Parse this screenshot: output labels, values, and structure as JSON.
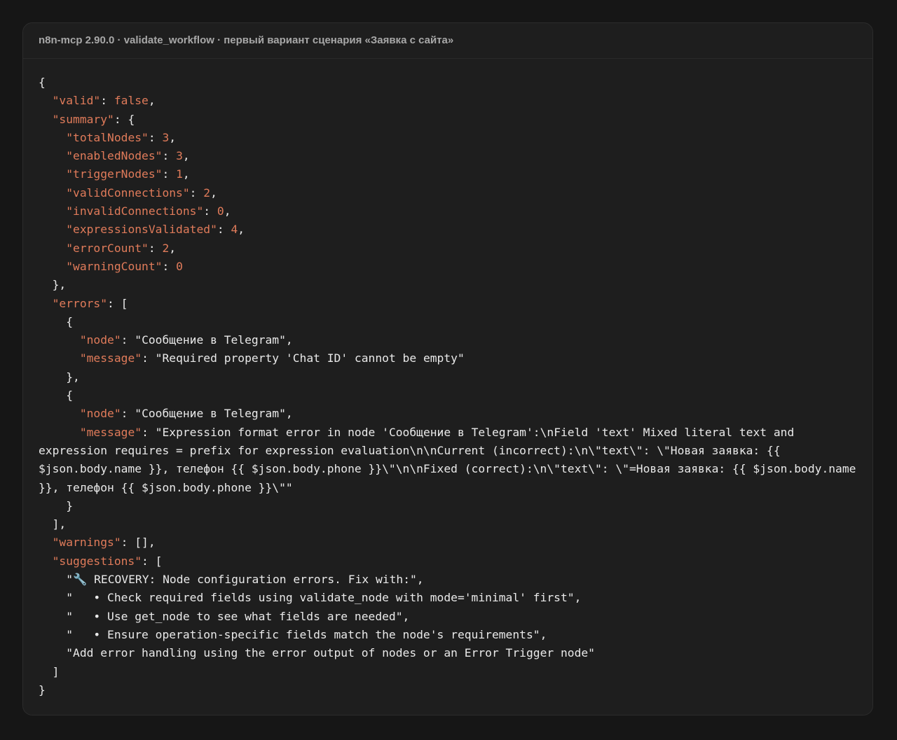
{
  "header": {
    "title": "n8n-mcp 2.90.0 · validate_workflow · первый вариант сценария «Заявка с сайта»"
  },
  "result": {
    "valid": "false",
    "summary": {
      "totalNodes": "3",
      "enabledNodes": "3",
      "triggerNodes": "1",
      "validConnections": "2",
      "invalidConnections": "0",
      "expressionsValidated": "4",
      "errorCount": "2",
      "warningCount": "0"
    },
    "errors": [
      {
        "node": "\"Сообщение в Telegram\"",
        "message": "\"Required property 'Chat ID' cannot be empty\""
      },
      {
        "node": "\"Сообщение в Telegram\"",
        "message": "\"Expression format error in node 'Сообщение в Telegram':\\nField 'text' Mixed literal text and expression requires = prefix for expression evaluation\\n\\nCurrent (incorrect):\\n\\\"text\\\": \\\"Новая заявка: {{ $json.body.name }}, телефон {{ $json.body.phone }}\\\"\\n\\nFixed (correct):\\n\\\"text\\\": \\\"=Новая заявка: {{ $json.body.name }}, телефон {{ $json.body.phone }}\\\"\""
      }
    ],
    "suggestions": [
      "\"🔧 RECOVERY: Node configuration errors. Fix with:\",",
      "\"   • Check required fields using validate_node with mode='minimal' first\",",
      "\"   • Use get_node to see what fields are needed\",",
      "\"   • Ensure operation-specific fields match the node's requirements\",",
      "\"Add error handling using the error output of nodes or an Error Trigger node\""
    ]
  }
}
